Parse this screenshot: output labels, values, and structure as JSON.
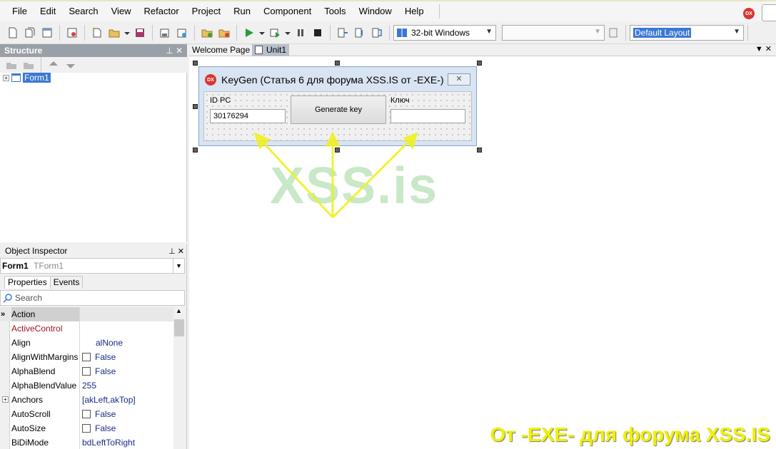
{
  "menu": [
    "File",
    "Edit",
    "Search",
    "View",
    "Refactor",
    "Project",
    "Run",
    "Component",
    "Tools",
    "Window",
    "Help"
  ],
  "menu_badge": "DX",
  "toolbar": {
    "platform": "32-bit Windows",
    "config": "",
    "layout": "Default Layout"
  },
  "structure": {
    "title": "Structure",
    "tree_item": "Form1"
  },
  "inspector": {
    "title": "Object Inspector",
    "object_name": "Form1",
    "object_type": "TForm1",
    "tab_properties": "Properties",
    "tab_events": "Events",
    "search_placeholder": "Search",
    "rows": [
      {
        "name": "Action",
        "value": ""
      },
      {
        "name": "ActiveControl",
        "value": ""
      },
      {
        "name": "Align",
        "value": "alNone"
      },
      {
        "name": "AlignWithMargins",
        "value": "False"
      },
      {
        "name": "AlphaBlend",
        "value": "False"
      },
      {
        "name": "AlphaBlendValue",
        "value": "255"
      },
      {
        "name": "Anchors",
        "value": "[akLeft,akTop]"
      },
      {
        "name": "AutoScroll",
        "value": "False"
      },
      {
        "name": "AutoSize",
        "value": "False"
      },
      {
        "name": "BiDiMode",
        "value": "bdLeftToRight"
      }
    ]
  },
  "editor": {
    "tabs": [
      "Welcome Page",
      "Unit1"
    ]
  },
  "form": {
    "icon": "DX",
    "caption": "KeyGen (Статья 6 для форума XSS.IS от -EXE-)",
    "label_id": "ID PC",
    "id_value": "30176294",
    "button": "Generate key",
    "label_key": "Ключ",
    "key_value": ""
  },
  "watermark": "XSS.is",
  "caption": "От -EXE- для форума XSS.IS",
  "colors": {
    "accent": "#3a78d4",
    "watermark": "#c8e8c8",
    "caption": "#f0f000",
    "arrows": "#f0f020"
  }
}
